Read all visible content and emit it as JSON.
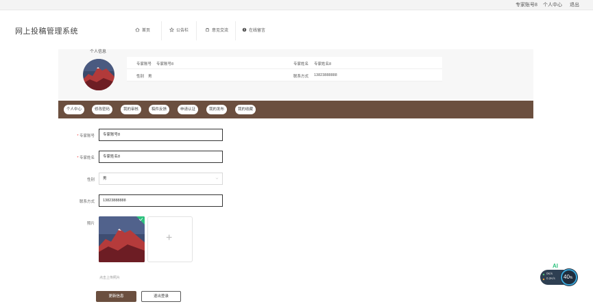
{
  "topbar": {
    "user": "专家账号8",
    "personal_center": "个人中心",
    "logout": "退出"
  },
  "header": {
    "logo": "网上投稿管理系统",
    "nav": [
      {
        "label": "首页",
        "icon": "home-icon"
      },
      {
        "label": "公告栏",
        "icon": "star-icon"
      },
      {
        "label": "意见交流",
        "icon": "chat-icon"
      },
      {
        "label": "在线留言",
        "icon": "message-icon"
      }
    ]
  },
  "profile": {
    "title": "个人信息",
    "expert_account_label": "专家账号",
    "expert_account": "专家账号8",
    "expert_name_label": "专家姓名",
    "expert_name": "专家姓名8",
    "gender_label": "性别",
    "gender": "男",
    "phone_label": "联系方式",
    "phone": "13823888888"
  },
  "tabs": [
    "个人中心",
    "修改密码",
    "我的审核",
    "稿件反馈",
    "申请认证",
    "我的发布",
    "我的收藏"
  ],
  "form": {
    "account_label": "专家账号",
    "account_value": "专家账号8",
    "name_label": "专家姓名",
    "name_value": "专家姓名8",
    "gender_label": "性别",
    "gender_value": "男",
    "phone_label": "联系方式",
    "phone_value": "13823888888",
    "photo_label": "照片",
    "upload_hint": "点击上传照片",
    "submit": "更新信息",
    "logout": "退出登录"
  },
  "widget": {
    "line1": "0K/s",
    "line2": "0.2K/s",
    "percent": "40",
    "percent_sign": "%",
    "ai": "AI"
  },
  "colors": {
    "accent": "#6b4f3f",
    "required": "#e44444",
    "upload_ok": "#2ec27e"
  }
}
